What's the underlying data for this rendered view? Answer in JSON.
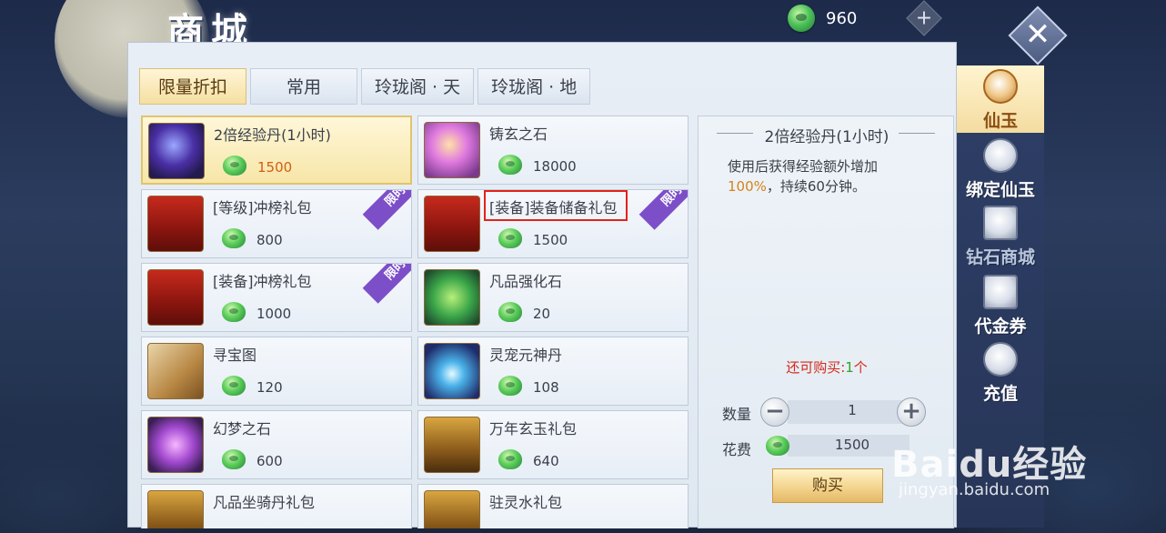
{
  "screen_title": "商城",
  "currency": {
    "value": "960",
    "icon": "jade-icon",
    "add_label": "+"
  },
  "close_label": "✕",
  "tabs": [
    {
      "label": "限量折扣",
      "active": true
    },
    {
      "label": "常用",
      "active": false
    },
    {
      "label": "玲珑阁 · 天",
      "active": false
    },
    {
      "label": "玲珑阁 · 地",
      "active": false
    }
  ],
  "items": [
    {
      "name": "2倍经验丹(1小时)",
      "price": "1500",
      "icon": "exp-orb-icon",
      "limited": false,
      "selected": true
    },
    {
      "name": "铸玄之石",
      "price": "18000",
      "icon": "gem-stone-icon",
      "limited": false
    },
    {
      "name": "[等级]冲榜礼包",
      "price": "800",
      "icon": "red-chest-icon",
      "limited": true
    },
    {
      "name": "[装备]装备储备礼包",
      "price": "1500",
      "icon": "red-chest-icon",
      "limited": true,
      "highlighted": true
    },
    {
      "name": "[装备]冲榜礼包",
      "price": "1000",
      "icon": "red-chest-icon",
      "limited": true
    },
    {
      "name": "凡品强化石",
      "price": "20",
      "icon": "green-stone-icon",
      "limited": false
    },
    {
      "name": "寻宝图",
      "price": "120",
      "icon": "scroll-map-icon",
      "limited": false
    },
    {
      "name": "灵宠元神丹",
      "price": "108",
      "icon": "blue-orb-icon",
      "limited": false
    },
    {
      "name": "幻梦之石",
      "price": "600",
      "icon": "crystal-icon",
      "limited": false
    },
    {
      "name": "万年玄玉礼包",
      "price": "640",
      "icon": "gold-chest-icon",
      "limited": false
    },
    {
      "name": "凡品坐骑丹礼包",
      "price": "",
      "icon": "gold-chest-icon",
      "limited": false
    },
    {
      "name": "驻灵水礼包",
      "price": "",
      "icon": "gold-chest-icon",
      "limited": false
    }
  ],
  "limited_label": "限时",
  "detail": {
    "title": "2倍经验丹(1小时)",
    "desc_before": "使用后获得经验额外增加",
    "desc_accent": "100%",
    "desc_after": "，持续60分钟。",
    "remain_label": "还可购买:",
    "remain_count": "1",
    "remain_unit": "个",
    "qty_label": "数量",
    "qty_value": "1",
    "qty_minus": "−",
    "qty_plus": "+",
    "cost_label": "花费",
    "cost_value": "1500",
    "buy_label": "购买"
  },
  "sidebar": [
    {
      "label": "仙玉",
      "icon": "jade-coin-icon",
      "active": true
    },
    {
      "label": "绑定仙玉",
      "icon": "bound-jade-icon",
      "active": false
    },
    {
      "label": "钻石商城",
      "icon": "diamond-shop-icon",
      "active": false,
      "dim": true
    },
    {
      "label": "代金券",
      "icon": "voucher-icon",
      "active": false
    },
    {
      "label": "充值",
      "icon": "recharge-icon",
      "active": false
    }
  ],
  "watermark": {
    "main": "Baidu经验",
    "sub": "jingyan.baidu.com"
  },
  "colors": {
    "accent": "#d4841a",
    "price_selected": "#d45d12",
    "warn": "#d42a1a",
    "badge": "#7c4fc8",
    "highlight": "#e2231a"
  }
}
